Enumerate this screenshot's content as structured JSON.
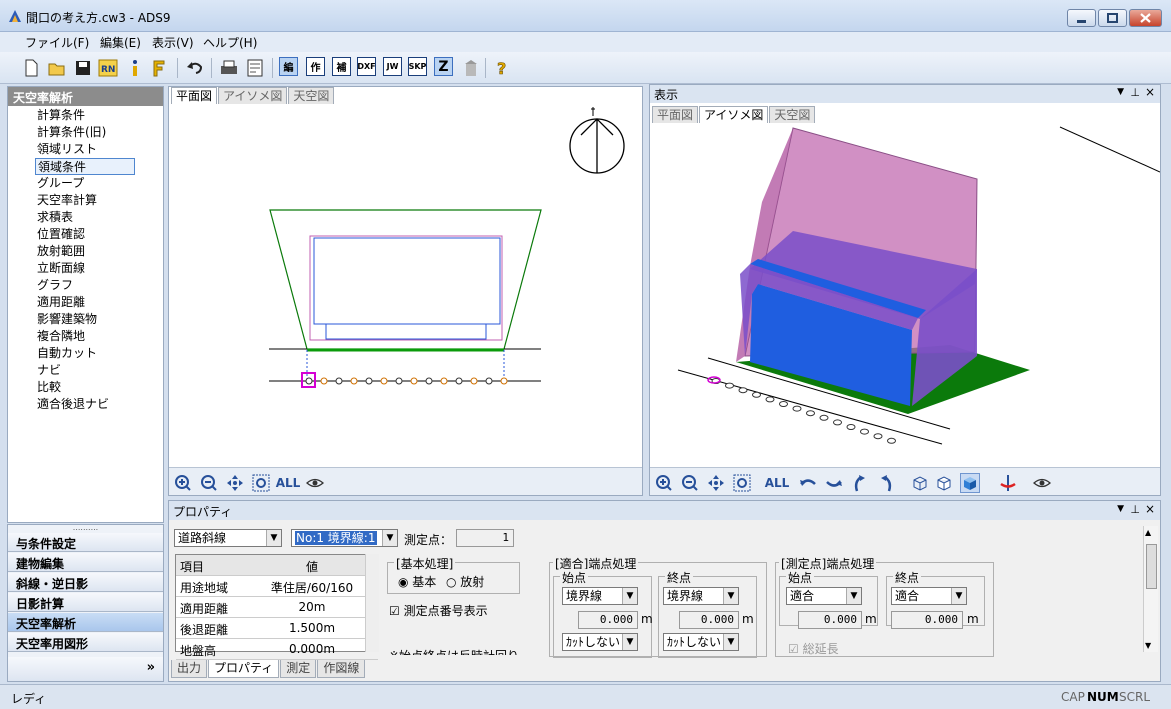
{
  "window": {
    "title": "間口の考え方.cw3 - ADS9"
  },
  "menu": [
    "ファイル(F)",
    "編集(E)",
    "表示(V)",
    "ヘルプ(H)"
  ],
  "toolbar": {
    "buttons": [
      "編",
      "作",
      "補",
      "DXF",
      "JW",
      "SKP",
      "Z"
    ]
  },
  "left_panel": {
    "header": "天空率解析",
    "items": [
      "計算条件",
      "計算条件(旧)",
      "領域リスト",
      "領域条件",
      "グループ",
      "天空率計算",
      "求積表",
      "位置確認",
      "放射範囲",
      "立断面線",
      "グラフ",
      "適用距離",
      "影響建築物",
      "複合隣地",
      "自動カット",
      "ナビ",
      "比較",
      "適合後退ナビ"
    ],
    "selected": "領域条件",
    "sections": [
      "与条件設定",
      "建物編集",
      "斜線・逆日影",
      "日影計算",
      "天空率解析",
      "天空率用図形"
    ],
    "selected_section": "天空率解析",
    "more": "»"
  },
  "plan_view": {
    "tabs": [
      "平面図",
      "アイソメ図",
      "天空図"
    ],
    "active_tab": "平面図",
    "zoom_all": "ALL"
  },
  "display_view": {
    "title": "表示",
    "tabs": [
      "平面図",
      "アイソメ図",
      "天空図"
    ],
    "active_tab": "アイソメ図",
    "zoom_all": "ALL"
  },
  "properties": {
    "title": "プロパティ",
    "line_type": "道路斜線",
    "boundary": "No:1 境界線:1",
    "measure_label": "測定点：",
    "measure_value": "1",
    "grid_headers": [
      "項目",
      "値"
    ],
    "grid_rows": [
      {
        "item": "用途地域",
        "value": "準住居/60/160"
      },
      {
        "item": "適用距離",
        "value": "20m"
      },
      {
        "item": "後退距離",
        "value": "1.500m"
      },
      {
        "item": "地盤高",
        "value": "0.000m"
      }
    ],
    "basic": {
      "title": "[基本処理]",
      "opt1": "基本",
      "opt2": "放射",
      "selected": "基本"
    },
    "show_numbers": "測定点番号表示",
    "note": "※始点終点は反時計回り",
    "fit_end": {
      "title": "[適合]端点処理",
      "start": "始点",
      "end": "終点",
      "start_combo": "境界線",
      "end_combo": "境界線",
      "start_value": "0.000",
      "end_value": "0.000",
      "unit": "m",
      "start_cut": "ｶｯﾄしない",
      "end_cut": "ｶｯﾄしない"
    },
    "measure_end": {
      "title": "[測定点]端点処理",
      "start": "始点",
      "end": "終点",
      "start_combo": "適合",
      "end_combo": "適合",
      "start_value": "0.000",
      "end_value": "0.000",
      "unit": "m",
      "total_len": "総延長"
    },
    "bottom_tabs": [
      "出力",
      "プロパティ",
      "測定",
      "作図線"
    ],
    "active_bottom_tab": "プロパティ"
  },
  "status": {
    "text": "レディ",
    "cap": "CAP",
    "num": "NUM",
    "scrl": "SCRL"
  },
  "colors": {
    "accent": "#316ac5",
    "building_blue": "#1f5ee0",
    "envelope_pink": "#c26bb0",
    "ground_green": "#0b7a0b"
  }
}
